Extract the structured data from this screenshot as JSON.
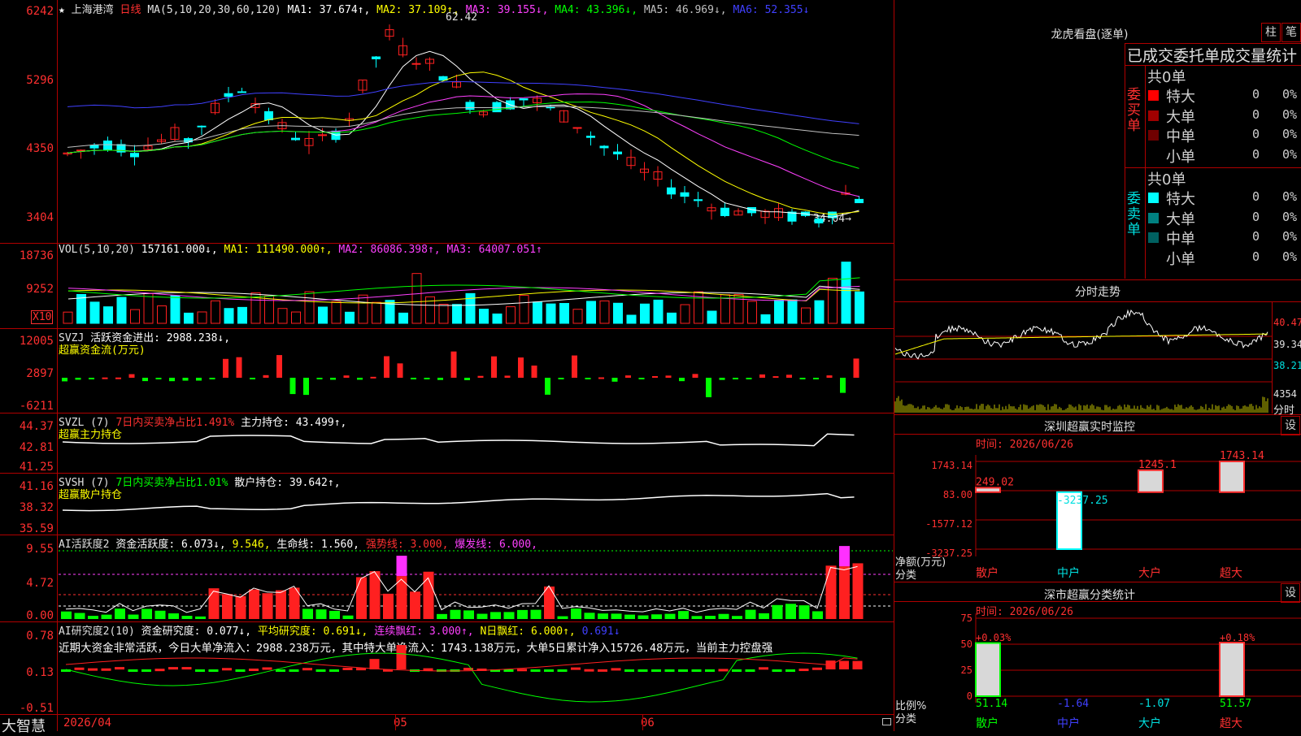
{
  "app": {
    "brand": "大智慧"
  },
  "header": {
    "star": "★",
    "stock": "上海港湾",
    "period": "日线",
    "ma_label": "MA(5,10,20,30,60,120)",
    "ma1": "MA1: 37.674↑,",
    "ma2": "MA2: 37.109↑,",
    "ma3": "MA3: 39.155↓,",
    "ma4": "MA4: 43.396↓,",
    "ma5": "MA5: 46.969↓,",
    "ma6": "MA6: 52.355↓"
  },
  "colors": {
    "up": "#ff2020",
    "down": "#00ffff",
    "grid": "#b00000",
    "ma1": "#ffffff",
    "ma2": "#ffff00",
    "ma3": "#ff40ff",
    "ma4": "#00ff00",
    "ma5": "#c0c0c0",
    "ma6": "#4040ff"
  },
  "price_panel": {
    "ticks": [
      "6242",
      "5296",
      "4350",
      "3404"
    ],
    "high_label": "62.42",
    "low_label": "34.04→"
  },
  "vol_panel": {
    "ticks": [
      "18736",
      "9252"
    ],
    "unit": "X10",
    "title": "VOL(5,10,20)",
    "v": "157161.000↓,",
    "ma1": "MA1: 111490.000↑,",
    "ma2": "MA2: 86086.398↑,",
    "ma3": "MA3: 64007.051↑"
  },
  "svzj_panel": {
    "ticks": [
      "12005",
      "2897",
      "-6211"
    ],
    "title": "SVZJ",
    "desc": "活跃资金进出: 2988.238↓,",
    "sub": "超赢资金流(万元)"
  },
  "svzl_panel": {
    "ticks": [
      "44.37",
      "42.81",
      "41.25"
    ],
    "title": "SVZL (7)",
    "ratio": "7日内买卖净占比1.491%",
    "hold": "主力持仓: 43.499↑,",
    "sub": "超赢主力持仓"
  },
  "svsh_panel": {
    "ticks": [
      "41.16",
      "38.32",
      "35.59"
    ],
    "title": "SVSH (7)",
    "ratio": "7日内买卖净占比1.01%",
    "hold": "散户持仓: 39.642↑,",
    "sub": "超赢散户持仓"
  },
  "ai1_panel": {
    "ticks": [
      "9.55",
      "4.72",
      "0.00"
    ],
    "title": "AI活跃度2",
    "a": "资金活跃度: 6.073↓,",
    "b": "9.546,",
    "c": "生命线: 1.560,",
    "d": "强势线: 3.000,",
    "e": "爆发线: 6.000,"
  },
  "ai2_panel": {
    "ticks": [
      "0.78",
      "0.13",
      "-0.51"
    ],
    "title": "AI研究度2(10)",
    "a": "资金研究度: 0.077↓,",
    "b": "平均研究度: 0.691↓,",
    "c": "连续飘红: 3.000↑,",
    "d": "N日飘红: 6.000↑,",
    "e": "0.691↓",
    "note": "近期大资金非常活跃，今日大单净流入：2988.238万元，其中特大单净流入：1743.138万元，大单5日累计净入15726.48万元，当前主力控盘强"
  },
  "date_axis": [
    "2026/04",
    "05",
    "06"
  ],
  "dragon": {
    "title": "龙虎看盘(逐单)",
    "btn_bar": "柱",
    "btn_pen": "笔",
    "subtitle": "已成交委托单成交量统计",
    "buy_label": "委买单",
    "sell_label": "委卖单",
    "buy_total": "共0单",
    "sell_total": "共0单",
    "buy_rows": [
      {
        "name": "特大",
        "count": "0",
        "pct": "0%",
        "color": "#ff0000"
      },
      {
        "name": "大单",
        "count": "0",
        "pct": "0%",
        "color": "#a00000"
      },
      {
        "name": "中单",
        "count": "0",
        "pct": "0%",
        "color": "#700000"
      },
      {
        "name": "小单",
        "count": "0",
        "pct": "0%",
        "color": "#000000"
      }
    ],
    "sell_rows": [
      {
        "name": "特大",
        "count": "0",
        "pct": "0%",
        "color": "#00ffff"
      },
      {
        "name": "大单",
        "count": "0",
        "pct": "0%",
        "color": "#008080"
      },
      {
        "name": "中单",
        "count": "0",
        "pct": "0%",
        "color": "#006060"
      },
      {
        "name": "小单",
        "count": "0",
        "pct": "0%",
        "color": "#000000"
      }
    ]
  },
  "intraday": {
    "title": "分时走势",
    "ticks": [
      "40.47",
      "39.34",
      "38.21"
    ],
    "vol_tick": "4354",
    "vol_label": "分时"
  },
  "monitor": {
    "title": "深圳超赢实时监控",
    "set": "设",
    "time": "时间: 2026/06/26",
    "ticks": [
      "1743.14",
      "83.00",
      "-1577.12",
      "-3237.25"
    ],
    "y_title": "净额(万元)",
    "x_title": "分类",
    "categories": [
      "散户",
      "中户",
      "大户",
      "超大"
    ],
    "values": [
      "249.02",
      "-3237.25",
      "1245.1",
      "1743.14"
    ]
  },
  "classify": {
    "title": "深市超赢分类统计",
    "set": "设",
    "time": "时间: 2026/06/26",
    "ticks": [
      "75",
      "50",
      "25",
      "0"
    ],
    "y_title": "比例%",
    "x_title": "分类",
    "categories": [
      "散户",
      "中户",
      "大户",
      "超大"
    ],
    "values": [
      "51.14",
      "-1.64",
      "-1.07",
      "51.57"
    ],
    "top_labels": [
      "+0.03%",
      "+0.18%"
    ]
  },
  "chart_data": [
    {
      "type": "candlestick",
      "title": "上海港湾 日线",
      "y_ticks": [
        6242,
        5296,
        4350,
        3404
      ],
      "high": 62.42,
      "low": 34.04,
      "x_ticks": [
        "2026/04",
        "05",
        "06"
      ],
      "series": [
        {
          "name": "MA1",
          "values": [
            37.674
          ]
        },
        {
          "name": "MA2",
          "values": [
            37.109
          ]
        },
        {
          "name": "MA3",
          "values": [
            39.155
          ]
        },
        {
          "name": "MA4",
          "values": [
            43.396
          ]
        },
        {
          "name": "MA5",
          "values": [
            46.969
          ]
        },
        {
          "name": "MA6",
          "values": [
            52.355
          ]
        }
      ]
    },
    {
      "type": "bar",
      "title": "VOL(5,10,20)",
      "y_ticks": [
        18736,
        9252
      ],
      "series": [
        {
          "name": "MA1",
          "values": [
            111490.0
          ]
        },
        {
          "name": "MA2",
          "values": [
            86086.398
          ]
        },
        {
          "name": "MA3",
          "values": [
            64007.051
          ]
        }
      ]
    },
    {
      "type": "bar",
      "title": "深圳超赢实时监控",
      "categories": [
        "散户",
        "中户",
        "大户",
        "超大"
      ],
      "values": [
        249.02,
        -3237.25,
        1245.1,
        1743.14
      ],
      "ylim": [
        -3237.25,
        1743.14
      ]
    },
    {
      "type": "bar",
      "title": "深市超赢分类统计",
      "categories": [
        "散户",
        "中户",
        "大户",
        "超大"
      ],
      "values": [
        51.14,
        -1.64,
        -1.07,
        51.57
      ],
      "ylim": [
        0,
        75
      ]
    }
  ]
}
